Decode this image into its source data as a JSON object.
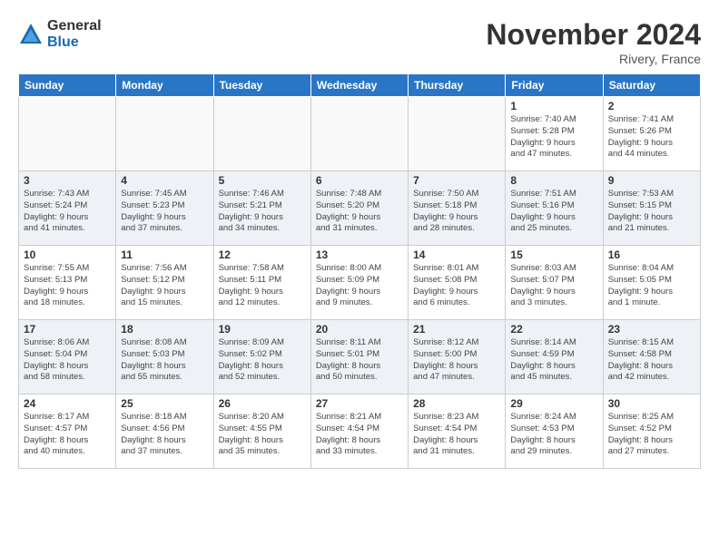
{
  "logo": {
    "general": "General",
    "blue": "Blue"
  },
  "title": "November 2024",
  "location": "Rivery, France",
  "days_of_week": [
    "Sunday",
    "Monday",
    "Tuesday",
    "Wednesday",
    "Thursday",
    "Friday",
    "Saturday"
  ],
  "weeks": [
    {
      "shaded": false,
      "days": [
        {
          "date": "",
          "info": ""
        },
        {
          "date": "",
          "info": ""
        },
        {
          "date": "",
          "info": ""
        },
        {
          "date": "",
          "info": ""
        },
        {
          "date": "",
          "info": ""
        },
        {
          "date": "1",
          "info": "Sunrise: 7:40 AM\nSunset: 5:28 PM\nDaylight: 9 hours\nand 47 minutes."
        },
        {
          "date": "2",
          "info": "Sunrise: 7:41 AM\nSunset: 5:26 PM\nDaylight: 9 hours\nand 44 minutes."
        }
      ]
    },
    {
      "shaded": true,
      "days": [
        {
          "date": "3",
          "info": "Sunrise: 7:43 AM\nSunset: 5:24 PM\nDaylight: 9 hours\nand 41 minutes."
        },
        {
          "date": "4",
          "info": "Sunrise: 7:45 AM\nSunset: 5:23 PM\nDaylight: 9 hours\nand 37 minutes."
        },
        {
          "date": "5",
          "info": "Sunrise: 7:46 AM\nSunset: 5:21 PM\nDaylight: 9 hours\nand 34 minutes."
        },
        {
          "date": "6",
          "info": "Sunrise: 7:48 AM\nSunset: 5:20 PM\nDaylight: 9 hours\nand 31 minutes."
        },
        {
          "date": "7",
          "info": "Sunrise: 7:50 AM\nSunset: 5:18 PM\nDaylight: 9 hours\nand 28 minutes."
        },
        {
          "date": "8",
          "info": "Sunrise: 7:51 AM\nSunset: 5:16 PM\nDaylight: 9 hours\nand 25 minutes."
        },
        {
          "date": "9",
          "info": "Sunrise: 7:53 AM\nSunset: 5:15 PM\nDaylight: 9 hours\nand 21 minutes."
        }
      ]
    },
    {
      "shaded": false,
      "days": [
        {
          "date": "10",
          "info": "Sunrise: 7:55 AM\nSunset: 5:13 PM\nDaylight: 9 hours\nand 18 minutes."
        },
        {
          "date": "11",
          "info": "Sunrise: 7:56 AM\nSunset: 5:12 PM\nDaylight: 9 hours\nand 15 minutes."
        },
        {
          "date": "12",
          "info": "Sunrise: 7:58 AM\nSunset: 5:11 PM\nDaylight: 9 hours\nand 12 minutes."
        },
        {
          "date": "13",
          "info": "Sunrise: 8:00 AM\nSunset: 5:09 PM\nDaylight: 9 hours\nand 9 minutes."
        },
        {
          "date": "14",
          "info": "Sunrise: 8:01 AM\nSunset: 5:08 PM\nDaylight: 9 hours\nand 6 minutes."
        },
        {
          "date": "15",
          "info": "Sunrise: 8:03 AM\nSunset: 5:07 PM\nDaylight: 9 hours\nand 3 minutes."
        },
        {
          "date": "16",
          "info": "Sunrise: 8:04 AM\nSunset: 5:05 PM\nDaylight: 9 hours\nand 1 minute."
        }
      ]
    },
    {
      "shaded": true,
      "days": [
        {
          "date": "17",
          "info": "Sunrise: 8:06 AM\nSunset: 5:04 PM\nDaylight: 8 hours\nand 58 minutes."
        },
        {
          "date": "18",
          "info": "Sunrise: 8:08 AM\nSunset: 5:03 PM\nDaylight: 8 hours\nand 55 minutes."
        },
        {
          "date": "19",
          "info": "Sunrise: 8:09 AM\nSunset: 5:02 PM\nDaylight: 8 hours\nand 52 minutes."
        },
        {
          "date": "20",
          "info": "Sunrise: 8:11 AM\nSunset: 5:01 PM\nDaylight: 8 hours\nand 50 minutes."
        },
        {
          "date": "21",
          "info": "Sunrise: 8:12 AM\nSunset: 5:00 PM\nDaylight: 8 hours\nand 47 minutes."
        },
        {
          "date": "22",
          "info": "Sunrise: 8:14 AM\nSunset: 4:59 PM\nDaylight: 8 hours\nand 45 minutes."
        },
        {
          "date": "23",
          "info": "Sunrise: 8:15 AM\nSunset: 4:58 PM\nDaylight: 8 hours\nand 42 minutes."
        }
      ]
    },
    {
      "shaded": false,
      "days": [
        {
          "date": "24",
          "info": "Sunrise: 8:17 AM\nSunset: 4:57 PM\nDaylight: 8 hours\nand 40 minutes."
        },
        {
          "date": "25",
          "info": "Sunrise: 8:18 AM\nSunset: 4:56 PM\nDaylight: 8 hours\nand 37 minutes."
        },
        {
          "date": "26",
          "info": "Sunrise: 8:20 AM\nSunset: 4:55 PM\nDaylight: 8 hours\nand 35 minutes."
        },
        {
          "date": "27",
          "info": "Sunrise: 8:21 AM\nSunset: 4:54 PM\nDaylight: 8 hours\nand 33 minutes."
        },
        {
          "date": "28",
          "info": "Sunrise: 8:23 AM\nSunset: 4:54 PM\nDaylight: 8 hours\nand 31 minutes."
        },
        {
          "date": "29",
          "info": "Sunrise: 8:24 AM\nSunset: 4:53 PM\nDaylight: 8 hours\nand 29 minutes."
        },
        {
          "date": "30",
          "info": "Sunrise: 8:25 AM\nSunset: 4:52 PM\nDaylight: 8 hours\nand 27 minutes."
        }
      ]
    }
  ]
}
